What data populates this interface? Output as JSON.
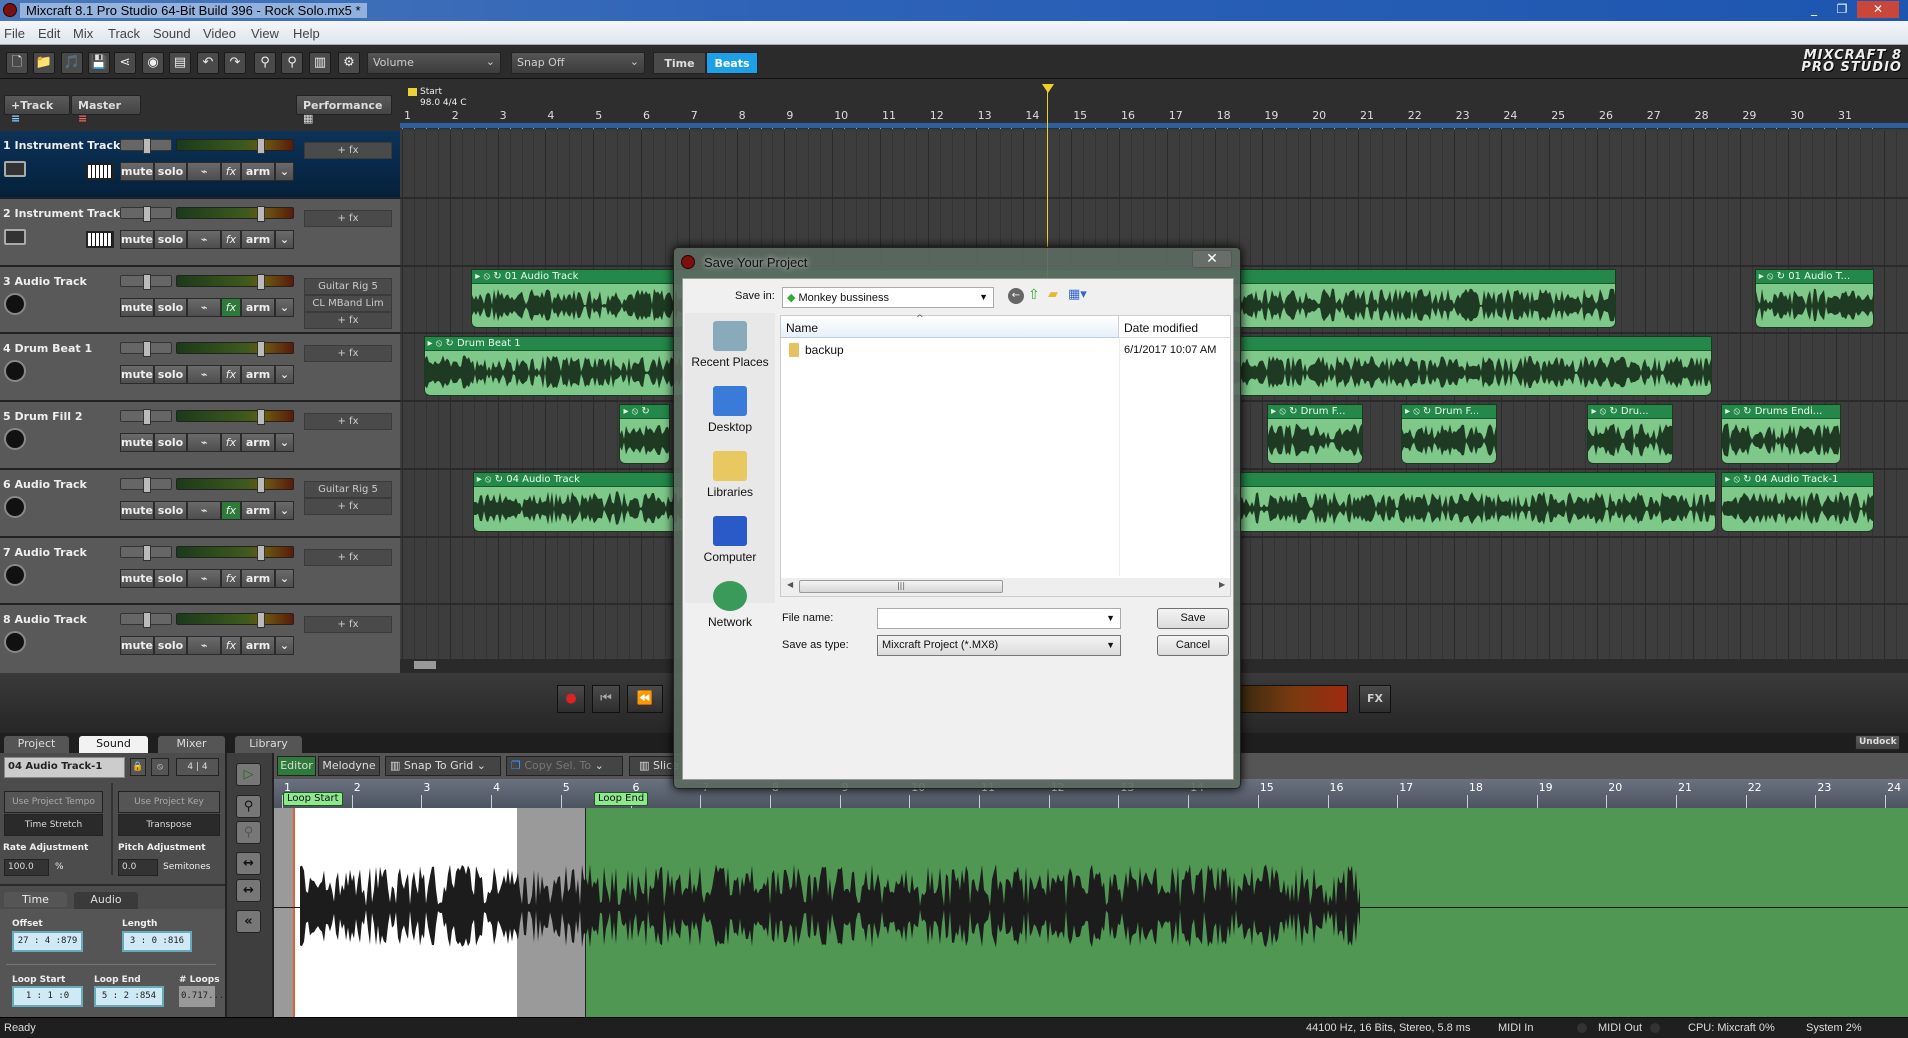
{
  "window": {
    "title": "Mixcraft 8.1 Pro Studio 64-Bit Build 396 - Rock Solo.mx5 *",
    "controls": [
      "minimize",
      "maximize",
      "close"
    ]
  },
  "menu": [
    "File",
    "Edit",
    "Mix",
    "Track",
    "Sound",
    "Video",
    "View",
    "Help"
  ],
  "toolbar": {
    "icons": [
      "new-file",
      "open-folder",
      "open-music",
      "save",
      "share",
      "burn-cd",
      "render-mix",
      "undo",
      "redo",
      "zoom-in",
      "zoom-out",
      "midi",
      "settings"
    ],
    "volume_select": "Volume",
    "snap_select": "Snap Off",
    "time_label": "Time",
    "beats_label": "Beats",
    "logo_line1": "MIXCRAFT 8",
    "logo_line2": "PRO STUDIO"
  },
  "track_controls": {
    "add_track": "+Track",
    "master": "Master",
    "performance": "Performance"
  },
  "ruler": {
    "marker_label": "Start",
    "marker_info": "98.0 4/4 C",
    "bars": [
      1,
      2,
      3,
      4,
      5,
      6,
      7,
      8,
      9,
      10,
      11,
      12,
      13,
      14,
      15,
      16,
      17,
      18,
      19,
      20,
      21,
      22,
      23,
      24,
      25,
      26,
      27,
      28,
      29,
      30,
      31
    ],
    "playhead_bar": 14.5
  },
  "track_buttons": {
    "mute": "mute",
    "solo": "solo",
    "fx": "fx",
    "arm": "arm"
  },
  "tracks": [
    {
      "name": "1 Instrument Track",
      "type": "instrument",
      "selected": true,
      "fx": [
        "+ fx"
      ],
      "fx_active": false,
      "clips": []
    },
    {
      "name": "2 Instrument Track",
      "type": "instrument",
      "fx": [
        "+ fx"
      ],
      "fx_active": false,
      "clips": []
    },
    {
      "name": "3 Audio Track",
      "type": "audio",
      "fx": [
        "Guitar Rig 5",
        "CL MBand Lim",
        "+ fx"
      ],
      "fx_active": true,
      "clips": [
        {
          "name": "01 Audio Track",
          "start": 2.45,
          "end": 26.4
        },
        {
          "name": "01 Audio T...",
          "start": 29.3,
          "end": 31.8
        }
      ]
    },
    {
      "name": "4 Drum Beat 1",
      "type": "audio",
      "fx": [
        "+ fx"
      ],
      "fx_active": false,
      "clips": [
        {
          "name": "Drum Beat 1",
          "start": 1.45,
          "end": 28.4
        }
      ]
    },
    {
      "name": "5 Drum Fill 2",
      "type": "audio",
      "fx": [
        "+ fx"
      ],
      "fx_active": false,
      "clips": [
        {
          "name": "",
          "start": 5.55,
          "end": 6.6
        },
        {
          "name": "Drum F...",
          "start": 19.1,
          "end": 21.1
        },
        {
          "name": "Drum F...",
          "start": 21.9,
          "end": 23.9
        },
        {
          "name": "Dru...",
          "start": 25.8,
          "end": 27.6
        },
        {
          "name": "Drums Endi...",
          "start": 28.6,
          "end": 31.1
        }
      ]
    },
    {
      "name": "6 Audio Track",
      "type": "audio",
      "fx": [
        "Guitar Rig 5",
        "+ fx"
      ],
      "fx_active": true,
      "clips": [
        {
          "name": "04 Audio Track",
          "start": 2.48,
          "end": 28.5
        },
        {
          "name": "04 Audio Track-1",
          "start": 28.6,
          "end": 31.8
        }
      ]
    },
    {
      "name": "7 Audio Track",
      "type": "audio",
      "fx": [
        "+ fx"
      ],
      "fx_active": false,
      "clips": []
    },
    {
      "name": "8 Audio Track",
      "type": "audio",
      "fx": [
        "+ fx"
      ],
      "fx_active": false,
      "clips": []
    }
  ],
  "transport": {
    "fx_label": "FX"
  },
  "bottom": {
    "tabs": [
      "Project",
      "Sound",
      "Mixer",
      "Library"
    ],
    "active_tab": "Sound",
    "undock": "Undock",
    "clip_name": "04 Audio Track-1",
    "time_sig": "4 | 4",
    "use_project_tempo": "Use Project Tempo",
    "time_stretch": "Time Stretch",
    "use_project_key": "Use Project Key",
    "transpose": "Transpose",
    "rate_label": "Rate Adjustment",
    "rate_value": "100.0",
    "rate_unit": "%",
    "pitch_label": "Pitch Adjustment",
    "pitch_value": "0.0",
    "pitch_unit": "Semitones",
    "subtabs": [
      "Time",
      "Audio"
    ],
    "offset_label": "Offset",
    "offset_value": "27 : 4 :879",
    "length_label": "Length",
    "length_value": "3 : 0 :816",
    "loop_start_label": "Loop Start",
    "loop_start_value": "1 : 1 :0",
    "loop_end_label": "Loop End",
    "loop_end_value": "5 : 2 :854",
    "loops_label": "# Loops",
    "loops_value": "0.717...",
    "editor_btn": "Editor",
    "melodyne_btn": "Melodyne",
    "snap_to_grid": "Snap To Grid",
    "copy_sel_to": "Copy Sel. To",
    "slice": "Slice",
    "editor_bars": [
      1,
      2,
      3,
      4,
      5,
      6,
      7,
      8,
      9,
      10,
      11,
      12,
      13,
      14,
      15,
      16,
      17,
      18,
      19,
      20,
      21,
      22,
      23,
      24
    ],
    "loop_start_tag": "Loop Start",
    "loop_end_tag": "Loop End"
  },
  "status": {
    "ready": "Ready",
    "audio_format": "44100 Hz, 16 Bits, Stereo, 5.8 ms",
    "midi_in": "MIDI In",
    "midi_out": "MIDI Out",
    "cpu": "CPU: Mixcraft 0%",
    "system": "System 2%"
  },
  "dialog": {
    "title": "Save Your Project",
    "save_in_label": "Save in:",
    "save_in_value": "Monkey bussiness",
    "places": [
      "Recent Places",
      "Desktop",
      "Libraries",
      "Computer",
      "Network"
    ],
    "columns": [
      "Name",
      "Date modified"
    ],
    "files": [
      {
        "name": "backup",
        "date": "6/1/2017 10:07 AM"
      }
    ],
    "file_name_label": "File name:",
    "file_name_value": "",
    "save_type_label": "Save as type:",
    "save_type_value": "Mixcraft Project (*.MX8)",
    "save_btn": "Save",
    "cancel_btn": "Cancel"
  },
  "colors": {
    "accent": "#1ea0e8",
    "clip_body": "#7ec88a",
    "clip_header": "#24884a",
    "editor_bg": "#4f9752",
    "selected_track": "#0c3358"
  }
}
